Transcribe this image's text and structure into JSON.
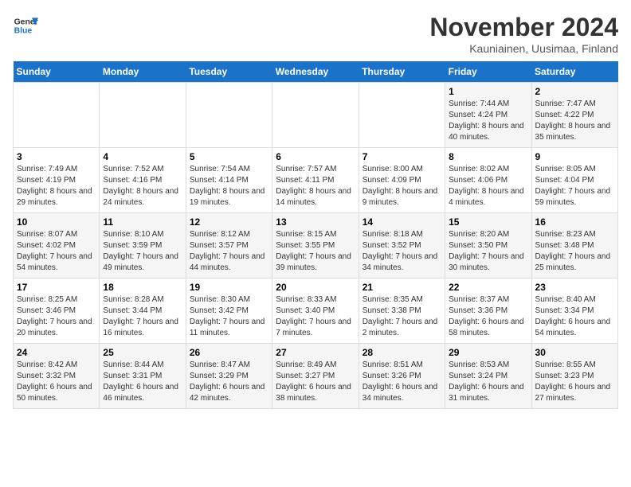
{
  "logo": {
    "line1": "General",
    "line2": "Blue"
  },
  "title": {
    "month_year": "November 2024",
    "location": "Kauniainen, Uusimaa, Finland"
  },
  "weekdays": [
    "Sunday",
    "Monday",
    "Tuesday",
    "Wednesday",
    "Thursday",
    "Friday",
    "Saturday"
  ],
  "weeks": [
    [
      {
        "day": "",
        "info": ""
      },
      {
        "day": "",
        "info": ""
      },
      {
        "day": "",
        "info": ""
      },
      {
        "day": "",
        "info": ""
      },
      {
        "day": "",
        "info": ""
      },
      {
        "day": "1",
        "info": "Sunrise: 7:44 AM\nSunset: 4:24 PM\nDaylight: 8 hours and 40 minutes."
      },
      {
        "day": "2",
        "info": "Sunrise: 7:47 AM\nSunset: 4:22 PM\nDaylight: 8 hours and 35 minutes."
      }
    ],
    [
      {
        "day": "3",
        "info": "Sunrise: 7:49 AM\nSunset: 4:19 PM\nDaylight: 8 hours and 29 minutes."
      },
      {
        "day": "4",
        "info": "Sunrise: 7:52 AM\nSunset: 4:16 PM\nDaylight: 8 hours and 24 minutes."
      },
      {
        "day": "5",
        "info": "Sunrise: 7:54 AM\nSunset: 4:14 PM\nDaylight: 8 hours and 19 minutes."
      },
      {
        "day": "6",
        "info": "Sunrise: 7:57 AM\nSunset: 4:11 PM\nDaylight: 8 hours and 14 minutes."
      },
      {
        "day": "7",
        "info": "Sunrise: 8:00 AM\nSunset: 4:09 PM\nDaylight: 8 hours and 9 minutes."
      },
      {
        "day": "8",
        "info": "Sunrise: 8:02 AM\nSunset: 4:06 PM\nDaylight: 8 hours and 4 minutes."
      },
      {
        "day": "9",
        "info": "Sunrise: 8:05 AM\nSunset: 4:04 PM\nDaylight: 7 hours and 59 minutes."
      }
    ],
    [
      {
        "day": "10",
        "info": "Sunrise: 8:07 AM\nSunset: 4:02 PM\nDaylight: 7 hours and 54 minutes."
      },
      {
        "day": "11",
        "info": "Sunrise: 8:10 AM\nSunset: 3:59 PM\nDaylight: 7 hours and 49 minutes."
      },
      {
        "day": "12",
        "info": "Sunrise: 8:12 AM\nSunset: 3:57 PM\nDaylight: 7 hours and 44 minutes."
      },
      {
        "day": "13",
        "info": "Sunrise: 8:15 AM\nSunset: 3:55 PM\nDaylight: 7 hours and 39 minutes."
      },
      {
        "day": "14",
        "info": "Sunrise: 8:18 AM\nSunset: 3:52 PM\nDaylight: 7 hours and 34 minutes."
      },
      {
        "day": "15",
        "info": "Sunrise: 8:20 AM\nSunset: 3:50 PM\nDaylight: 7 hours and 30 minutes."
      },
      {
        "day": "16",
        "info": "Sunrise: 8:23 AM\nSunset: 3:48 PM\nDaylight: 7 hours and 25 minutes."
      }
    ],
    [
      {
        "day": "17",
        "info": "Sunrise: 8:25 AM\nSunset: 3:46 PM\nDaylight: 7 hours and 20 minutes."
      },
      {
        "day": "18",
        "info": "Sunrise: 8:28 AM\nSunset: 3:44 PM\nDaylight: 7 hours and 16 minutes."
      },
      {
        "day": "19",
        "info": "Sunrise: 8:30 AM\nSunset: 3:42 PM\nDaylight: 7 hours and 11 minutes."
      },
      {
        "day": "20",
        "info": "Sunrise: 8:33 AM\nSunset: 3:40 PM\nDaylight: 7 hours and 7 minutes."
      },
      {
        "day": "21",
        "info": "Sunrise: 8:35 AM\nSunset: 3:38 PM\nDaylight: 7 hours and 2 minutes."
      },
      {
        "day": "22",
        "info": "Sunrise: 8:37 AM\nSunset: 3:36 PM\nDaylight: 6 hours and 58 minutes."
      },
      {
        "day": "23",
        "info": "Sunrise: 8:40 AM\nSunset: 3:34 PM\nDaylight: 6 hours and 54 minutes."
      }
    ],
    [
      {
        "day": "24",
        "info": "Sunrise: 8:42 AM\nSunset: 3:32 PM\nDaylight: 6 hours and 50 minutes."
      },
      {
        "day": "25",
        "info": "Sunrise: 8:44 AM\nSunset: 3:31 PM\nDaylight: 6 hours and 46 minutes."
      },
      {
        "day": "26",
        "info": "Sunrise: 8:47 AM\nSunset: 3:29 PM\nDaylight: 6 hours and 42 minutes."
      },
      {
        "day": "27",
        "info": "Sunrise: 8:49 AM\nSunset: 3:27 PM\nDaylight: 6 hours and 38 minutes."
      },
      {
        "day": "28",
        "info": "Sunrise: 8:51 AM\nSunset: 3:26 PM\nDaylight: 6 hours and 34 minutes."
      },
      {
        "day": "29",
        "info": "Sunrise: 8:53 AM\nSunset: 3:24 PM\nDaylight: 6 hours and 31 minutes."
      },
      {
        "day": "30",
        "info": "Sunrise: 8:55 AM\nSunset: 3:23 PM\nDaylight: 6 hours and 27 minutes."
      }
    ]
  ]
}
